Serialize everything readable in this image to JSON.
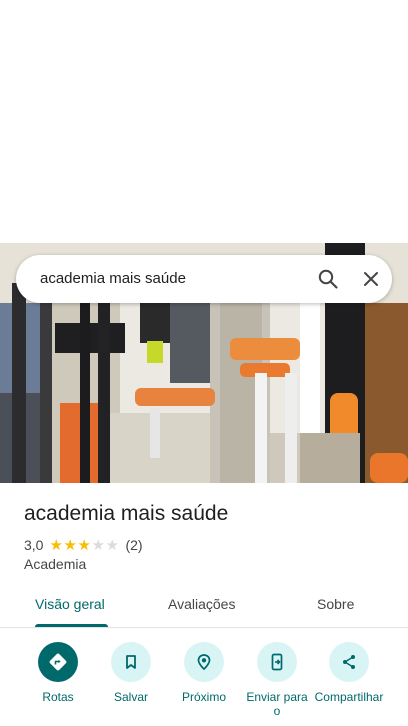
{
  "search": {
    "query": "academia mais saúde"
  },
  "place": {
    "title": "academia mais saúde",
    "rating": "3,0",
    "rating_stars": 3,
    "rating_max": 5,
    "review_count": "(2)",
    "category": "Academia"
  },
  "tabs": [
    {
      "label": "Visão geral",
      "active": true
    },
    {
      "label": "Avaliações",
      "active": false
    },
    {
      "label": "Sobre",
      "active": false
    }
  ],
  "actions": [
    {
      "label": "Rotas",
      "icon": "directions-icon"
    },
    {
      "label": "Salvar",
      "icon": "bookmark-icon"
    },
    {
      "label": "Próximo",
      "icon": "nearby-icon"
    },
    {
      "label": "Enviar para o",
      "icon": "send-to-phone-icon"
    },
    {
      "label": "Compartilhar",
      "icon": "share-icon"
    }
  ],
  "colors": {
    "accent": "#00696b",
    "accent_light": "#d8f4f4",
    "star": "#fbbc04"
  }
}
